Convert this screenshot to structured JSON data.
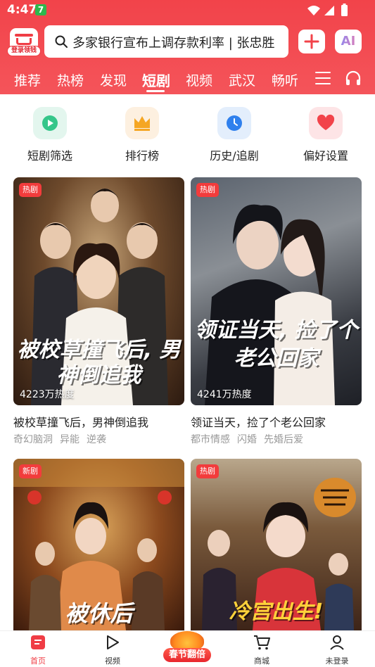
{
  "status_bar": {
    "time": "4:47",
    "badge": "7"
  },
  "header": {
    "login_label": "登录领钱",
    "search_text": "多家银行宣布上调存款利率 | 张忠胜",
    "ai_label": "AI"
  },
  "nav": {
    "tabs": [
      "推荐",
      "热榜",
      "发现",
      "短剧",
      "视频",
      "武汉",
      "畅听"
    ],
    "active": "短剧"
  },
  "quick_actions": [
    {
      "label": "短剧筛选",
      "icon": "play-icon",
      "bg": "#e3f6ee",
      "color": "#35c68a"
    },
    {
      "label": "排行榜",
      "icon": "crown-icon",
      "bg": "#fdf0e0",
      "color": "#f5a623"
    },
    {
      "label": "历史/追剧",
      "icon": "clock-icon",
      "bg": "#e3eefc",
      "color": "#2f80ed"
    },
    {
      "label": "偏好设置",
      "icon": "heart-icon",
      "bg": "#fde4e6",
      "color": "#f2434a"
    }
  ],
  "dramas": [
    {
      "tag": "热剧",
      "heat": "4223万热度",
      "poster_title": "被校草撞飞后, 男神倒追我",
      "title": "被校草撞飞后，男神倒追我",
      "genres": [
        "奇幻脑洞",
        "异能",
        "逆袭"
      ]
    },
    {
      "tag": "热剧",
      "heat": "4241万热度",
      "poster_title": "领证当天, 捡了个老公回家",
      "title": "领证当天，捡了个老公回家",
      "genres": [
        "都市情感",
        "闪婚",
        "先婚后爱"
      ]
    },
    {
      "tag": "新剧",
      "poster_title": "被休后"
    },
    {
      "tag": "热剧",
      "poster_title": "冷宫出生!"
    }
  ],
  "bottom_nav": {
    "home": "首页",
    "video": "视频",
    "promo": "春节翻倍",
    "mall": "商城",
    "profile": "未登录"
  },
  "colors": {
    "brand": "#f2434a",
    "tag": "#f23c3c"
  }
}
